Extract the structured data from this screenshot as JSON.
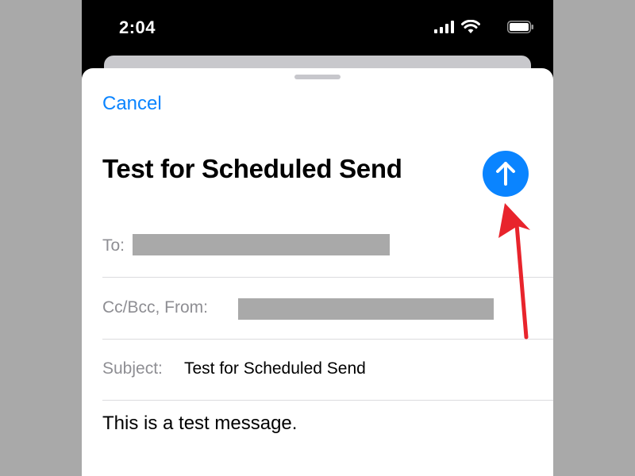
{
  "status_bar": {
    "time": "2:04",
    "icons": [
      "cellular-signal-icon",
      "wifi-icon",
      "battery-icon"
    ]
  },
  "compose": {
    "cancel_label": "Cancel",
    "title": "Test for Scheduled Send",
    "send_icon": "arrow-up-icon",
    "to_label": "To:",
    "cc_from_label": "Cc/Bcc, From:",
    "subject_label": "Subject:",
    "subject_value": "Test for Scheduled Send",
    "body": "This is a test message."
  },
  "colors": {
    "accent": "#0a84ff",
    "annotation": "#e8242c",
    "redaction": "#a9a9a9"
  }
}
